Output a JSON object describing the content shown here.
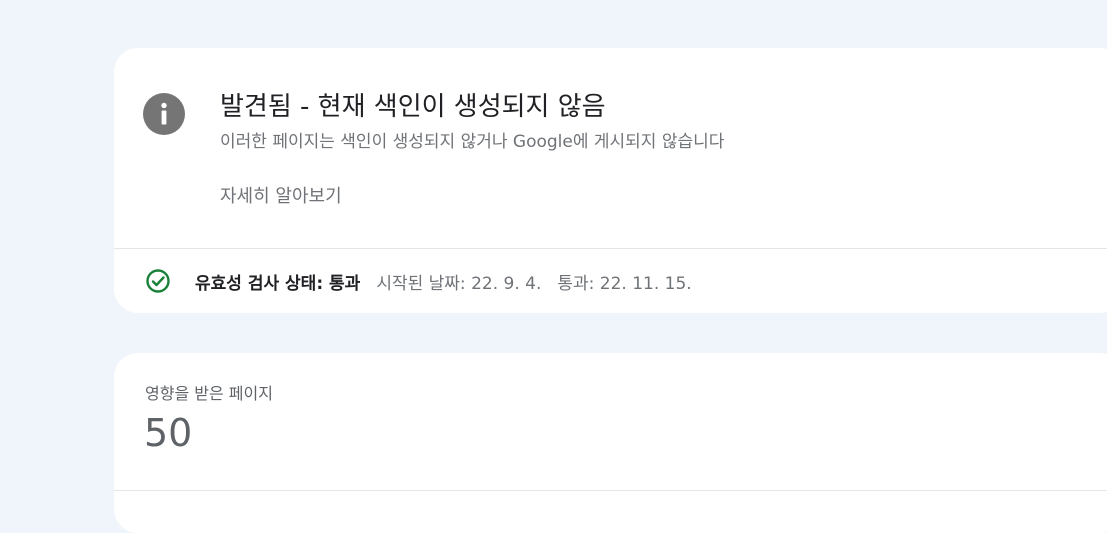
{
  "issue": {
    "title": "발견됨 - 현재 색인이 생성되지 않음",
    "description": "이러한 페이지는 색인이 생성되지 않거나 Google에 게시되지 않습니다",
    "learn_more": "자세히 알아보기",
    "icon": "info-icon"
  },
  "validation": {
    "icon": "check-circle-icon",
    "status_label": "유효성 검사 상태: 통과",
    "started": "시작된 날짜: 22. 9. 4.",
    "passed": "통과: 22. 11. 15."
  },
  "affected_pages": {
    "label": "영향을 받은 페이지",
    "value": "50"
  },
  "colors": {
    "background": "#f0f4fb",
    "card": "#ffffff",
    "info_icon": "#757575",
    "success": "#188038"
  }
}
